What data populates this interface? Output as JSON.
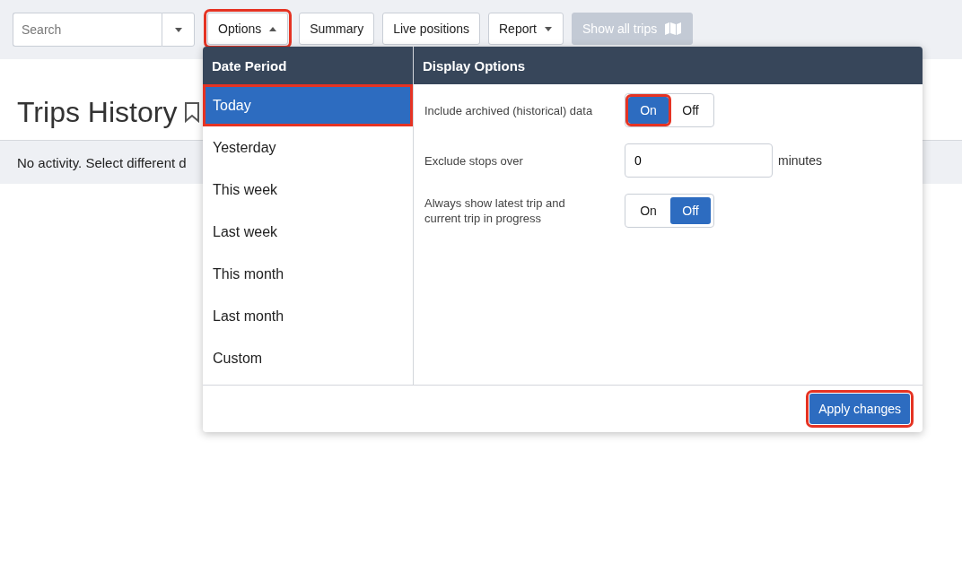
{
  "toolbar": {
    "search": {
      "placeholder": "Search"
    },
    "buttons": [
      {
        "label": "Options",
        "kind": "dropdown",
        "expanded": true,
        "highlighted": true,
        "disabled": false
      },
      {
        "label": "Summary",
        "kind": "plain",
        "highlighted": false,
        "disabled": false
      },
      {
        "label": "Live positions",
        "kind": "plain",
        "highlighted": false,
        "disabled": false
      },
      {
        "label": "Report",
        "kind": "dropdown",
        "expanded": false,
        "highlighted": false,
        "disabled": false
      },
      {
        "label": "Show all trips",
        "kind": "map",
        "highlighted": false,
        "disabled": true
      }
    ]
  },
  "page": {
    "title": "Trips History",
    "message": "No activity. Select different d"
  },
  "options_popup": {
    "date_period": {
      "title": "Date Period",
      "items": [
        {
          "label": "Today",
          "selected": true,
          "highlighted": true
        },
        {
          "label": "Yesterday",
          "selected": false,
          "highlighted": false
        },
        {
          "label": "This week",
          "selected": false,
          "highlighted": false
        },
        {
          "label": "Last week",
          "selected": false,
          "highlighted": false
        },
        {
          "label": "This month",
          "selected": false,
          "highlighted": false
        },
        {
          "label": "Last month",
          "selected": false,
          "highlighted": false
        },
        {
          "label": "Custom",
          "selected": false,
          "highlighted": false
        }
      ]
    },
    "display_options": {
      "title": "Display Options",
      "rows": [
        {
          "kind": "toggle",
          "label": "Include archived (historical) data",
          "segments": [
            {
              "label": "On",
              "selected": true,
              "highlighted": true
            },
            {
              "label": "Off",
              "selected": false,
              "highlighted": false
            }
          ]
        },
        {
          "kind": "number",
          "label": "Exclude stops over",
          "value": "0",
          "unit": "minutes"
        },
        {
          "kind": "toggle",
          "label": "Always show latest trip and current trip in progress",
          "segments": [
            {
              "label": "On",
              "selected": false,
              "highlighted": false
            },
            {
              "label": "Off",
              "selected": true,
              "highlighted": false
            }
          ]
        }
      ]
    },
    "apply_button": {
      "label": "Apply changes",
      "highlighted": true
    }
  }
}
